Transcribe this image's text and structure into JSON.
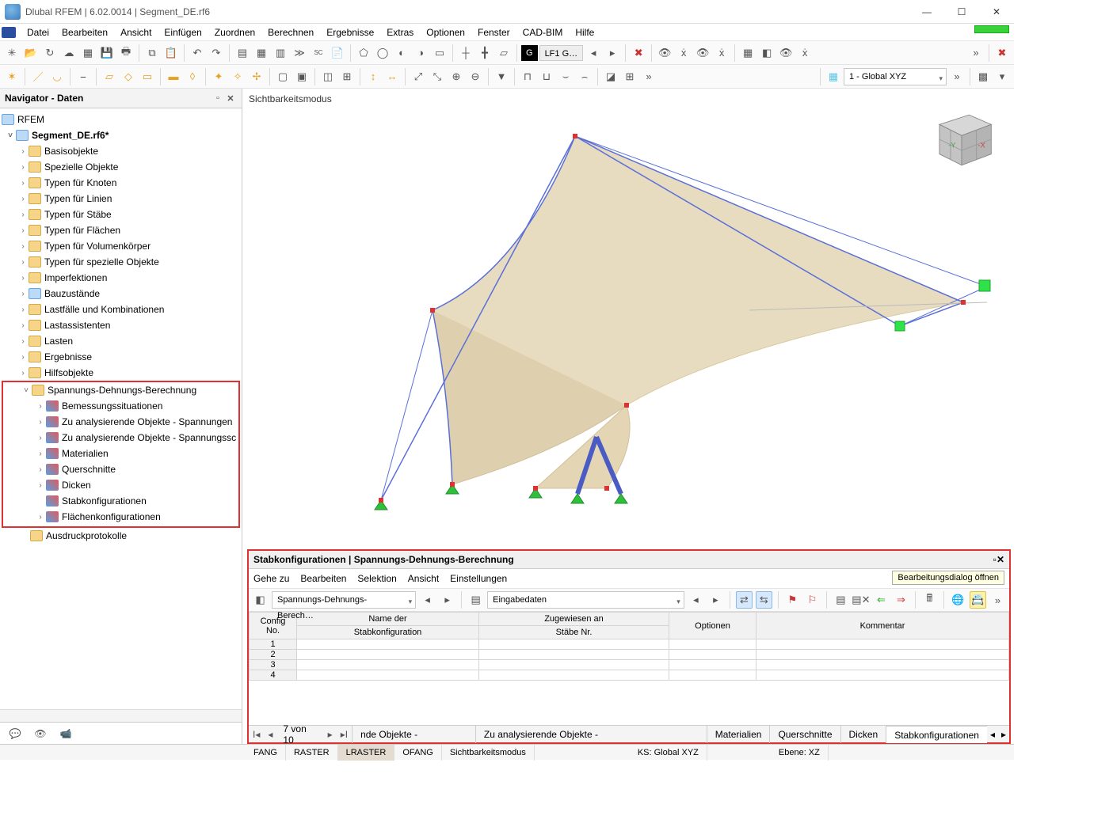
{
  "title": "Dlubal RFEM | 6.02.0014 | Segment_DE.rf6",
  "menu": [
    "Datei",
    "Bearbeiten",
    "Ansicht",
    "Einfügen",
    "Zuordnen",
    "Berechnen",
    "Ergebnisse",
    "Extras",
    "Optionen",
    "Fenster",
    "CAD-BIM",
    "Hilfe"
  ],
  "loadcase": {
    "black": "G",
    "grey": "LF1  G…"
  },
  "coord_dropdown": "1 - Global XYZ",
  "navigator": {
    "title": "Navigator - Daten",
    "root": "RFEM",
    "file": "Segment_DE.rf6*",
    "items": [
      "Basisobjekte",
      "Spezielle Objekte",
      "Typen für Knoten",
      "Typen für Linien",
      "Typen für Stäbe",
      "Typen für Flächen",
      "Typen für Volumenkörper",
      "Typen für spezielle Objekte",
      "Imperfektionen",
      "Bauzustände",
      "Lastfälle und Kombinationen",
      "Lastassistenten",
      "Lasten",
      "Ergebnisse",
      "Hilfsobjekte"
    ],
    "highlight_parent": "Spannungs-Dehnungs-Berechnung",
    "highlight_children": [
      "Bemessungssituationen",
      "Zu analysierende Objekte - Spannungen",
      "Zu analysierende Objekte - Spannungsschwingbreiten",
      "Materialien",
      "Querschnitte",
      "Dicken",
      "Stabkonfigurationen",
      "Flächenkonfigurationen"
    ],
    "after": "Ausdruckprotokolle"
  },
  "viewport_label": "Sichtbarkeitsmodus",
  "panel": {
    "title": "Stabkonfigurationen | Spannungs-Dehnungs-Berechnung",
    "menu": [
      "Gehe zu",
      "Bearbeiten",
      "Selektion",
      "Ansicht",
      "Einstellungen"
    ],
    "tooltip": "Bearbeitungsdialog öffnen",
    "dd1": "Spannungs-Dehnungs-Berech…",
    "dd2": "Eingabedaten",
    "cols": {
      "c1a": "Config",
      "c1b": "No.",
      "c2a": "Name der",
      "c2b": "Stabkonfiguration",
      "c3a": "Zugewiesen an",
      "c3b": "Stäbe Nr.",
      "c4": "Optionen",
      "c5": "Kommentar"
    },
    "rows": [
      "1",
      "2",
      "3",
      "4"
    ],
    "pager": "7 von 10",
    "tabs": [
      "nde Objekte - Spannungen",
      "Zu analysierende Objekte - Spannungsschwingbreiten",
      "Materialien",
      "Querschnitte",
      "Dicken",
      "Stabkonfigurationen"
    ]
  },
  "status": {
    "s1": "FANG",
    "s2": "RASTER",
    "s3": "LRASTER",
    "s4": "OFANG",
    "s5": "Sichtbarkeitsmodus",
    "s6": "KS: Global XYZ",
    "s7": "Ebene: XZ"
  }
}
